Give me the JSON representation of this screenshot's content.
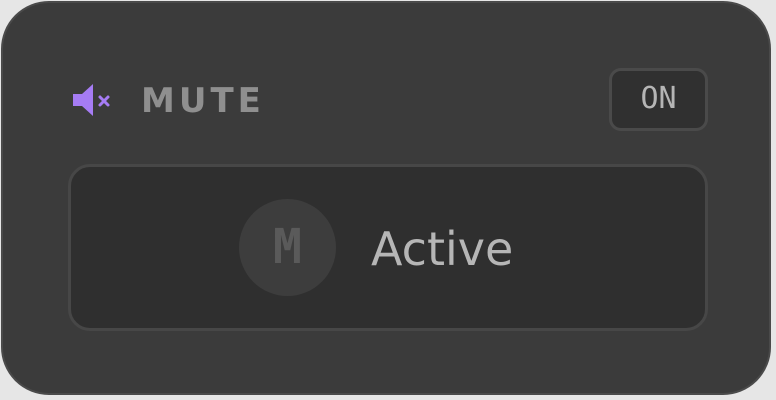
{
  "header": {
    "icon": "speaker-muted-icon",
    "title": "MUTE",
    "toggle_label": "ON"
  },
  "panel": {
    "avatar_letter": "M",
    "status": "Active"
  },
  "colors": {
    "accent": "#a67cf4",
    "card_background": "#3b3b3b",
    "panel_background": "#2f2f2f",
    "text_muted": "#8f8f8f",
    "text_primary": "#b6b6b6"
  }
}
